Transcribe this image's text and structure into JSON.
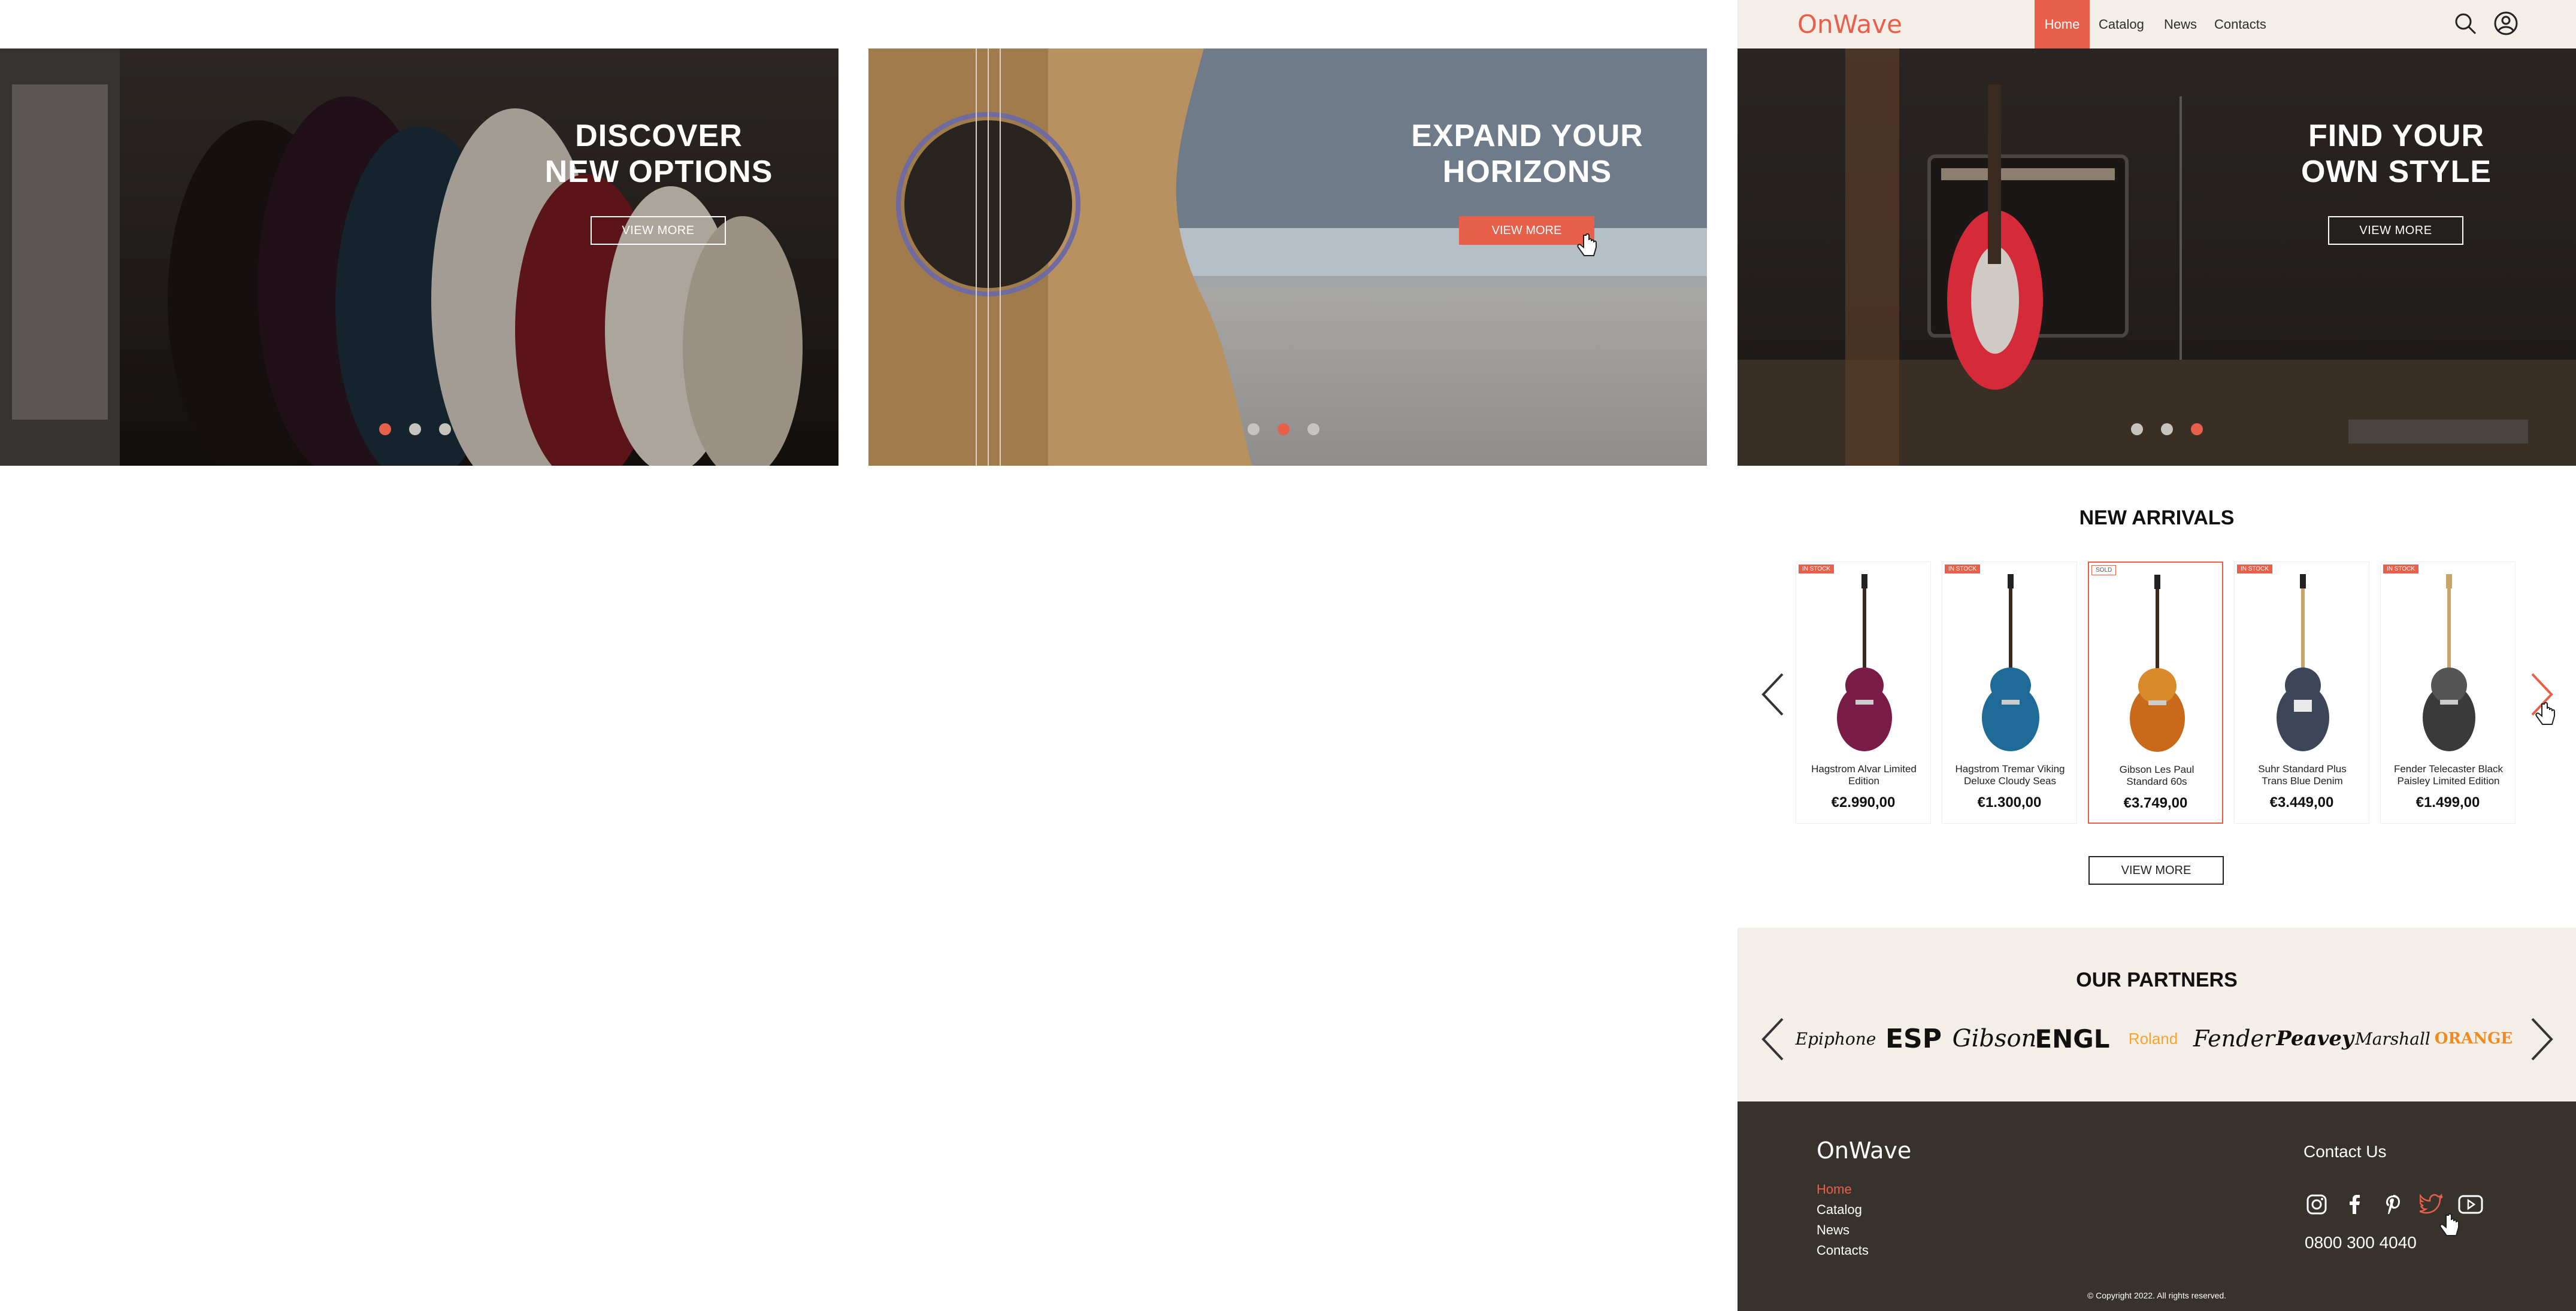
{
  "nav": {
    "logo": "OnWave",
    "items": [
      "Home",
      "Catalog",
      "News",
      "Contacts"
    ],
    "active": "Home"
  },
  "heroes": [
    {
      "title_line1": "DISCOVER",
      "title_line2": "NEW OPTIONS",
      "button": "VIEW MORE",
      "active_dot": 1
    },
    {
      "title_line1": "EXPAND YOUR",
      "title_line2": "HORIZONS",
      "button": "VIEW MORE",
      "active_dot": 2
    },
    {
      "title_line1": "FIND YOUR",
      "title_line2": "OWN STYLE",
      "button": "VIEW MORE",
      "active_dot": 3
    }
  ],
  "new_arrivals": {
    "heading": "NEW ARRIVALS",
    "products": [
      {
        "badge": "IN STOCK",
        "name_line1": "Hagstrom Alvar Limited",
        "name_line2": "Edition",
        "price": "€2.990,00",
        "body_color": "#7a1c48"
      },
      {
        "badge": "IN STOCK",
        "name_line1": "Hagstrom Tremar Viking",
        "name_line2": "Deluxe Cloudy Seas",
        "price": "€1.300,00",
        "body_color": "#1d6b96"
      },
      {
        "badge": "SOLD",
        "name_line1": "Gibson Les Paul",
        "name_line2": "Standard 60s",
        "price": "€3.749,00",
        "body_color": "#c96a1a"
      },
      {
        "badge": "IN STOCK",
        "name_line1": "Suhr Standard Plus",
        "name_line2": "Trans Blue Denim",
        "price": "€3.449,00",
        "body_color": "#3c4658"
      },
      {
        "badge": "IN STOCK",
        "name_line1": "Fender Telecaster Black",
        "name_line2": "Paisley Limited Edition",
        "price": "€1.499,00",
        "body_color": "#3a3a3a"
      }
    ],
    "view_more": "VIEW MORE"
  },
  "partners": {
    "heading": "OUR PARTNERS",
    "brands": [
      "Epiphone",
      "ESP",
      "Gibson",
      "ENGL",
      "Roland",
      "Fender",
      "Peavey",
      "Marshall",
      "ORANGE"
    ]
  },
  "footer": {
    "logo": "OnWave",
    "links": [
      "Home",
      "Catalog",
      "News",
      "Contacts"
    ],
    "contact_heading": "Contact Us",
    "phone": "0800 300 4040",
    "social_icons": [
      "instagram-icon",
      "facebook-icon",
      "pinterest-icon",
      "twitter-icon",
      "youtube-icon"
    ],
    "copyright": "© Copyright 2022. All rights reserved."
  },
  "colors": {
    "accent": "#e8604a",
    "nav_bg": "#f4eee8",
    "partners_bg": "#f4eee8",
    "footer_bg": "#38322d"
  }
}
